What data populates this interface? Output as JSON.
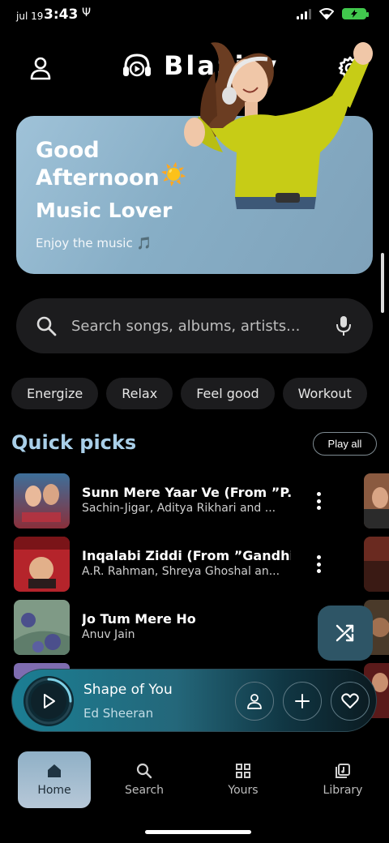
{
  "status_bar": {
    "date": "jul 19",
    "time": "3:43",
    "battery_icon": "battery-icon",
    "signal_icon": "signal-icon",
    "wifi_icon": "wifi-icon",
    "usb_icon": "usb-icon"
  },
  "header": {
    "app_name": "Blazify",
    "profile_icon": "user-icon",
    "settings_icon": "gear-icon",
    "logo_icon": "headphones-play-icon"
  },
  "banner": {
    "greeting": "Good Afternoon",
    "greeting_emoji": "☀️",
    "subtitle": "Music Lover",
    "tagline": "Enjoy the music 🎵",
    "background": "#8fb3cb"
  },
  "search": {
    "placeholder": "Search songs, albums, artists..."
  },
  "chips": [
    "Energize",
    "Relax",
    "Feel good",
    "Workout"
  ],
  "quick_picks": {
    "title": "Quick picks",
    "play_all_label": "Play all",
    "songs": [
      {
        "title": "Sunn Mere Yaar Ve (From ”P...",
        "artist": "Sachin-Jigar, Aditya Rikhari and ..."
      },
      {
        "title": "Inqalabi Ziddi (From ”Gandhi...",
        "artist": "A.R. Rahman, Shreya Ghoshal an..."
      },
      {
        "title": "Jo Tum Mere Ho",
        "artist": "Anuv Jain"
      }
    ]
  },
  "fab": {
    "icon": "shuffle-icon"
  },
  "player": {
    "title": "Shape of You",
    "artist": "Ed Sheeran",
    "progress": 0.25,
    "accent": "#1b7e93"
  },
  "nav": {
    "items": [
      {
        "label": "Home",
        "icon": "home-icon",
        "active": true
      },
      {
        "label": "Search",
        "icon": "search-icon",
        "active": false
      },
      {
        "label": "Yours",
        "icon": "grid-icon",
        "active": false
      },
      {
        "label": "Library",
        "icon": "library-icon",
        "active": false
      }
    ]
  }
}
